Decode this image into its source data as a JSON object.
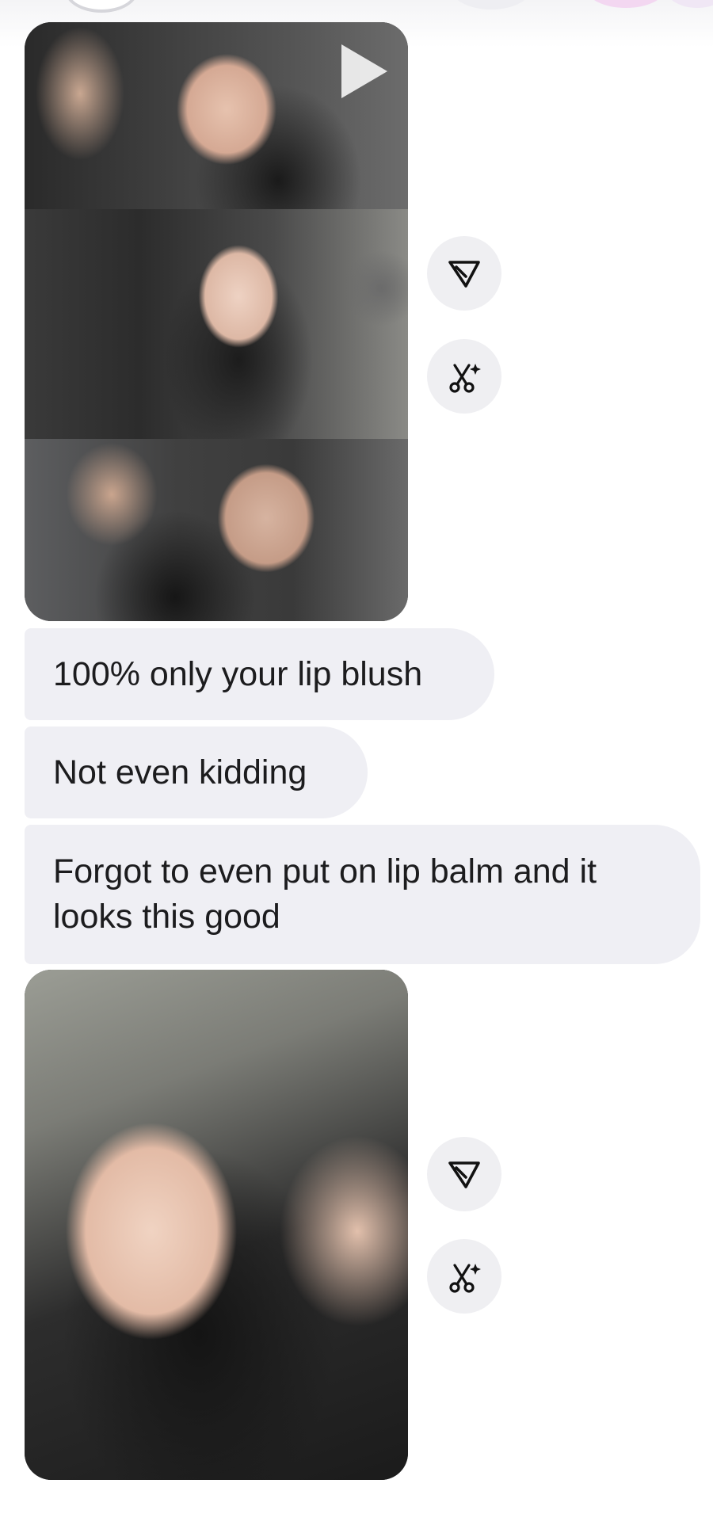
{
  "messages": [
    {
      "type": "media",
      "description_icon": "video-thumbnail",
      "has_play_icon": true
    },
    {
      "type": "text",
      "text": "100% only your lip blush"
    },
    {
      "type": "text",
      "text": "Not even kidding"
    },
    {
      "type": "text",
      "text": "Forgot to even put on lip balm and it looks this good"
    },
    {
      "type": "media",
      "description_icon": "photo"
    }
  ],
  "actions": {
    "share_icon": "paper-plane-icon",
    "ai_edit_icon": "scissors-sparkle-icon"
  },
  "colors": {
    "bubble_bg": "#efeff4",
    "action_bg": "#efeff2",
    "text": "#1c1c1e"
  }
}
